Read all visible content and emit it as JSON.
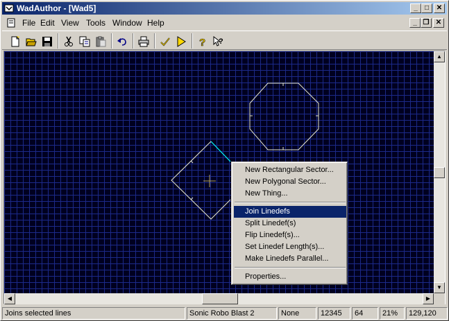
{
  "window": {
    "title": "WadAuthor - [Wad5]"
  },
  "menubar": {
    "items": [
      "File",
      "Edit",
      "View",
      "Tools",
      "Window",
      "Help"
    ]
  },
  "toolbar": {
    "buttons": [
      "new-icon",
      "open-icon",
      "save-icon",
      "cut-icon",
      "copy-icon",
      "paste-icon",
      "undo-icon",
      "print-icon",
      "check-icon",
      "run-icon",
      "help-icon",
      "context-help-icon"
    ]
  },
  "context_menu": {
    "items": [
      {
        "label": "New Rectangular Sector...",
        "selected": false
      },
      {
        "label": "New Polygonal Sector...",
        "selected": false
      },
      {
        "label": "New Thing...",
        "selected": false
      },
      {
        "label": "Join Linedefs",
        "selected": true
      },
      {
        "label": "Split Linedef(s)",
        "selected": false
      },
      {
        "label": "Flip Linedef(s)...",
        "selected": false
      },
      {
        "label": "Set Linedef Length(s)...",
        "selected": false
      },
      {
        "label": "Make Linedefs Parallel...",
        "selected": false
      },
      {
        "label": "Properties...",
        "selected": false
      }
    ]
  },
  "statusbar": {
    "message": "Joins selected lines",
    "game": "Sonic Robo Blast 2",
    "mode": "None",
    "value1": "12345",
    "grid": "64",
    "zoom": "21%",
    "coords": "129,120"
  },
  "colors": {
    "map_background": "#000020",
    "grid_line": "#1c2a8a",
    "linedef": "#e8e8d0",
    "selected_linedef": "#00ffff",
    "menu_highlight": "#0a246a"
  }
}
